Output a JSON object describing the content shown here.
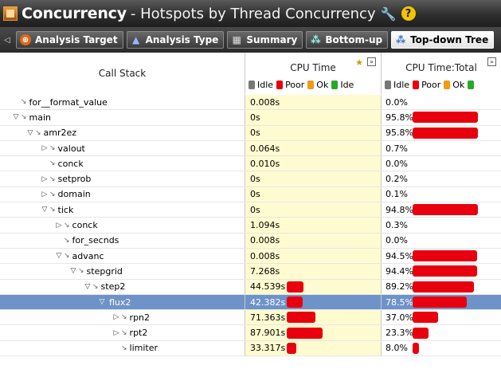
{
  "title": {
    "main": "Concurrency",
    "sub": "- Hotspots by Thread Concurrency",
    "wrench_glyph": "🔧",
    "help_glyph": "?"
  },
  "tabs": [
    {
      "label": "Analysis Target",
      "icon": "target-icon",
      "active": false
    },
    {
      "label": "Analysis Type",
      "icon": "analysis-type-icon",
      "active": false
    },
    {
      "label": "Summary",
      "icon": "summary-icon",
      "active": false
    },
    {
      "label": "Bottom-up",
      "icon": "bottom-up-icon",
      "active": false
    },
    {
      "label": "Top-down Tree",
      "icon": "top-down-tree-icon",
      "active": true
    }
  ],
  "columns": {
    "call_stack": "Call Stack",
    "cpu_time": "CPU Time",
    "cpu_time_total": "CPU Time:Total",
    "legend_cpu": [
      {
        "label": "Idle",
        "color": "#777777"
      },
      {
        "label": "Poor",
        "color": "#e8000e"
      },
      {
        "label": "Ok",
        "color": "#f09a18"
      },
      {
        "label": "Ide",
        "color": "#2aa82a"
      }
    ],
    "legend_total": [
      {
        "label": "Idle",
        "color": "#777777"
      },
      {
        "label": "Poor",
        "color": "#e8000e"
      },
      {
        "label": "Ok",
        "color": "#f09a18"
      },
      {
        "label": "",
        "color": "#2aa82a"
      }
    ]
  },
  "rows": [
    {
      "name": "for__format_value",
      "depth": 0,
      "twisty": "",
      "cpu": "0.008s",
      "cpu_bar_frac": 0,
      "total": "0.0%",
      "total_frac": 0.0
    },
    {
      "name": "main",
      "depth": 0,
      "twisty": "▽",
      "cpu": "0s",
      "cpu_bar_frac": 0,
      "total": "95.8%",
      "total_frac": 0.958
    },
    {
      "name": "amr2ez",
      "depth": 1,
      "twisty": "▽",
      "cpu": "0s",
      "cpu_bar_frac": 0,
      "total": "95.8%",
      "total_frac": 0.958
    },
    {
      "name": "valout",
      "depth": 2,
      "twisty": "▷",
      "cpu": "0.064s",
      "cpu_bar_frac": 0,
      "total": "0.7%",
      "total_frac": 0.0
    },
    {
      "name": "conck",
      "depth": 2,
      "twisty": "",
      "cpu": "0.010s",
      "cpu_bar_frac": 0,
      "total": "0.0%",
      "total_frac": 0.0
    },
    {
      "name": "setprob",
      "depth": 2,
      "twisty": "▷",
      "cpu": "0s",
      "cpu_bar_frac": 0,
      "total": "0.2%",
      "total_frac": 0.0
    },
    {
      "name": "domain",
      "depth": 2,
      "twisty": "▷",
      "cpu": "0s",
      "cpu_bar_frac": 0,
      "total": "0.1%",
      "total_frac": 0.0
    },
    {
      "name": "tick",
      "depth": 2,
      "twisty": "▽",
      "cpu": "0s",
      "cpu_bar_frac": 0,
      "total": "94.8%",
      "total_frac": 0.948
    },
    {
      "name": "conck",
      "depth": 3,
      "twisty": "▷",
      "cpu": "1.094s",
      "cpu_bar_frac": 0,
      "total": "0.3%",
      "total_frac": 0.0
    },
    {
      "name": "for_secnds",
      "depth": 3,
      "twisty": "",
      "cpu": "0.008s",
      "cpu_bar_frac": 0,
      "total": "0.0%",
      "total_frac": 0.0
    },
    {
      "name": "advanc",
      "depth": 3,
      "twisty": "▽",
      "cpu": "0.008s",
      "cpu_bar_frac": 0,
      "total": "94.5%",
      "total_frac": 0.945
    },
    {
      "name": "stepgrid",
      "depth": 4,
      "twisty": "▽",
      "cpu": "7.268s",
      "cpu_bar_frac": 0,
      "total": "94.4%",
      "total_frac": 0.944
    },
    {
      "name": "step2",
      "depth": 5,
      "twisty": "▽",
      "cpu": "44.539s",
      "cpu_bar_frac": 0.35,
      "total": "89.2%",
      "total_frac": 0.892
    },
    {
      "name": "flux2",
      "depth": 6,
      "twisty": "▽",
      "cpu": "42.382s",
      "cpu_bar_frac": 0.33,
      "total": "78.5%",
      "total_frac": 0.785,
      "selected": true
    },
    {
      "name": "rpn2",
      "depth": 7,
      "twisty": "▷",
      "cpu": "71.363s",
      "cpu_bar_frac": 0.6,
      "total": "37.0%",
      "total_frac": 0.37
    },
    {
      "name": "rpt2",
      "depth": 7,
      "twisty": "▷",
      "cpu": "87.901s",
      "cpu_bar_frac": 0.75,
      "total": "23.3%",
      "total_frac": 0.233
    },
    {
      "name": "limiter",
      "depth": 7,
      "twisty": "",
      "cpu": "33.317s",
      "cpu_bar_frac": 0.2,
      "total": "8.0%",
      "total_frac": 0.08
    }
  ]
}
